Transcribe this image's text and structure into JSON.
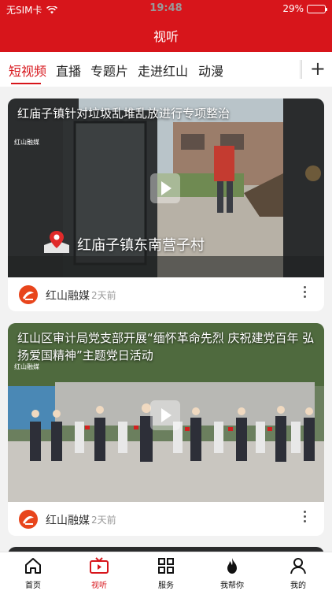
{
  "status_bar": {
    "carrier": "无SIM卡",
    "time": "19:48",
    "battery": "29%",
    "battery_level": 0.29
  },
  "header": {
    "title": "视听"
  },
  "tabs": [
    {
      "label": "短视频",
      "active": true
    },
    {
      "label": "直播",
      "active": false
    },
    {
      "label": "专题片",
      "active": false
    },
    {
      "label": "走进红山",
      "active": false
    },
    {
      "label": "动漫",
      "active": false
    }
  ],
  "add_tab_symbol": "+",
  "videos": [
    {
      "title": "红庙子镇针对垃圾乱堆乱放进行专项整治",
      "watermark": "红山融媒",
      "location": "红庙子镇东南营子村",
      "source": "红山融媒",
      "time": "2天前"
    },
    {
      "title": "红山区审计局党支部开展“缅怀革命先烈 庆祝建党百年 弘扬爱国精神”主题党日活动",
      "watermark": "红山融媒",
      "source": "红山融媒",
      "time": "2天前"
    }
  ],
  "bottom_nav": [
    {
      "label": "首页",
      "icon": "home-icon",
      "active": false
    },
    {
      "label": "视听",
      "icon": "tv-icon",
      "active": true
    },
    {
      "label": "服务",
      "icon": "grid-icon",
      "active": false
    },
    {
      "label": "我帮你",
      "icon": "flame-icon",
      "active": false
    },
    {
      "label": "我的",
      "icon": "user-icon",
      "active": false
    }
  ],
  "colors": {
    "brand_red": "#d7151b",
    "background": "#f2f2f2"
  }
}
